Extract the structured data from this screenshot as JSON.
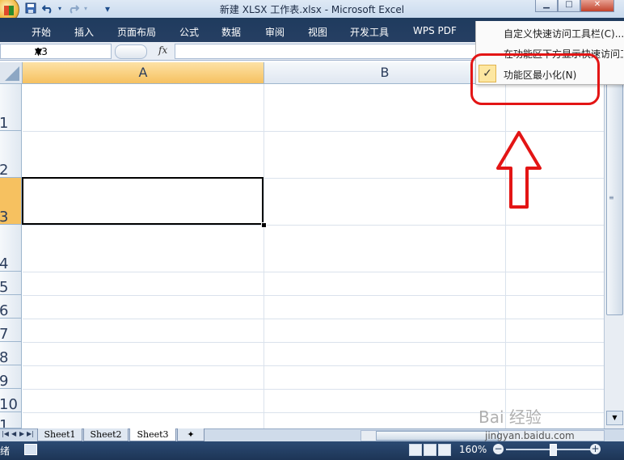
{
  "window": {
    "title": "新建 XLSX 工作表.xlsx - Microsoft Excel",
    "qat_customize_glyph": "▾",
    "buttons": {
      "minimize": "▁",
      "maximize": "□",
      "close": "✕"
    }
  },
  "ribbon": {
    "tabs": [
      "开始",
      "插入",
      "页面布局",
      "公式",
      "数据",
      "审阅",
      "视图",
      "开发工具",
      "WPS PDF"
    ]
  },
  "formula_bar": {
    "name_box": "A3",
    "fx_label": "fx",
    "formula": ""
  },
  "sheet": {
    "columns": [
      "A",
      "B"
    ],
    "rows": [
      "1",
      "2",
      "3",
      "4",
      "5",
      "6",
      "7",
      "8",
      "9",
      "10",
      "1"
    ],
    "selected_cell": "A3"
  },
  "sheet_tabs": [
    "Sheet1",
    "Sheet2",
    "Sheet3"
  ],
  "active_sheet": "Sheet3",
  "status_bar": {
    "status": "绪",
    "zoom": "160%",
    "zoom_minus": "−",
    "zoom_plus": "+"
  },
  "context_menu": {
    "items": [
      {
        "label": "自定义快速访问工具栏(C)...",
        "checked": false
      },
      {
        "label": "在功能区下方显示快速访问工",
        "checked": false
      },
      {
        "label": "功能区最小化(N)",
        "checked": true
      }
    ],
    "check_glyph": "✓"
  },
  "annotation": {
    "color": "#e31515"
  },
  "watermark": {
    "brand": "Bai 经验",
    "url": "jingyan.baidu.com"
  }
}
